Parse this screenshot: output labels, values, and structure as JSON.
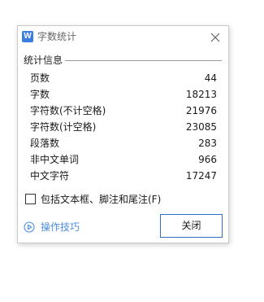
{
  "window": {
    "title": "字数统计",
    "app_icon_letter": "W",
    "close_icon": "close-icon",
    "colors": {
      "app_icon": "#3a7de3",
      "accent": "#2f6fc8",
      "link": "#4a8de0"
    }
  },
  "section": {
    "label": "统计信息"
  },
  "stats": [
    {
      "label": "页数",
      "value": "44"
    },
    {
      "label": "字数",
      "value": "18213"
    },
    {
      "label": "字符数(不计空格)",
      "value": "21976"
    },
    {
      "label": "字符数(计空格)",
      "value": "23085"
    },
    {
      "label": "段落数",
      "value": "283"
    },
    {
      "label": "非中文单词",
      "value": "966"
    },
    {
      "label": "中文字符",
      "value": "17247"
    }
  ],
  "options": {
    "include_textbox_label": "包括文本框、脚注和尾注(F)",
    "checked": false
  },
  "footer": {
    "tips_label": "操作技巧",
    "tips_icon": "play-circle-icon",
    "close_label": "关闭"
  }
}
